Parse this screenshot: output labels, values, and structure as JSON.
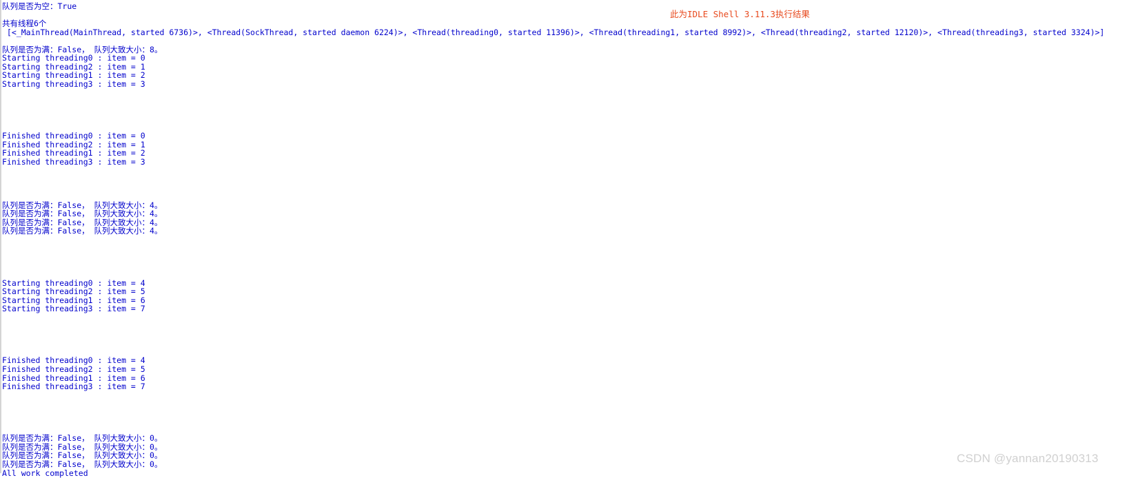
{
  "window": {
    "title": "IDLE Shell 3.11.3 execution output",
    "background_color": "#ffffff",
    "output_text_color": "#0000cc",
    "annotation_color": "#e8491d",
    "watermark_color": "#d0d0d0"
  },
  "annotation": {
    "text": "此为IDLE Shell 3.11.3执行结果"
  },
  "watermark": {
    "text": "CSDN @yannan20190313"
  },
  "console": {
    "lines": [
      "队列是否为空：True",
      "",
      "共有线程6个",
      " [<_MainThread(MainThread, started 6736)>, <Thread(SockThread, started daemon 6224)>, <Thread(threading0, started 11396)>, <Thread(threading1, started 8992)>, <Thread(threading2, started 12120)>, <Thread(threading3, started 3324)>]",
      "",
      "队列是否为满：False， 队列大致大小：8。",
      "Starting threading0 : item = 0",
      "Starting threading2 : item = 1",
      "Starting threading1 : item = 2",
      "Starting threading3 : item = 3",
      "",
      "",
      "",
      "",
      "",
      "Finished threading0 : item = 0",
      "Finished threading2 : item = 1",
      "Finished threading1 : item = 2",
      "Finished threading3 : item = 3",
      "",
      "",
      "",
      "",
      "队列是否为满：False， 队列大致大小：4。",
      "队列是否为满：False， 队列大致大小：4。",
      "队列是否为满：False， 队列大致大小：4。",
      "队列是否为满：False， 队列大致大小：4。",
      "",
      "",
      "",
      "",
      "",
      "Starting threading0 : item = 4",
      "Starting threading2 : item = 5",
      "Starting threading1 : item = 6",
      "Starting threading3 : item = 7",
      "",
      "",
      "",
      "",
      "",
      "Finished threading0 : item = 4",
      "Finished threading2 : item = 5",
      "Finished threading1 : item = 6",
      "Finished threading3 : item = 7",
      "",
      "",
      "",
      "",
      "",
      "队列是否为满：False， 队列大致大小：0。",
      "队列是否为满：False， 队列大致大小：0。",
      "队列是否为满：False， 队列大致大小：0。",
      "队列是否为满：False， 队列大致大小：0。",
      "All work completed"
    ]
  }
}
